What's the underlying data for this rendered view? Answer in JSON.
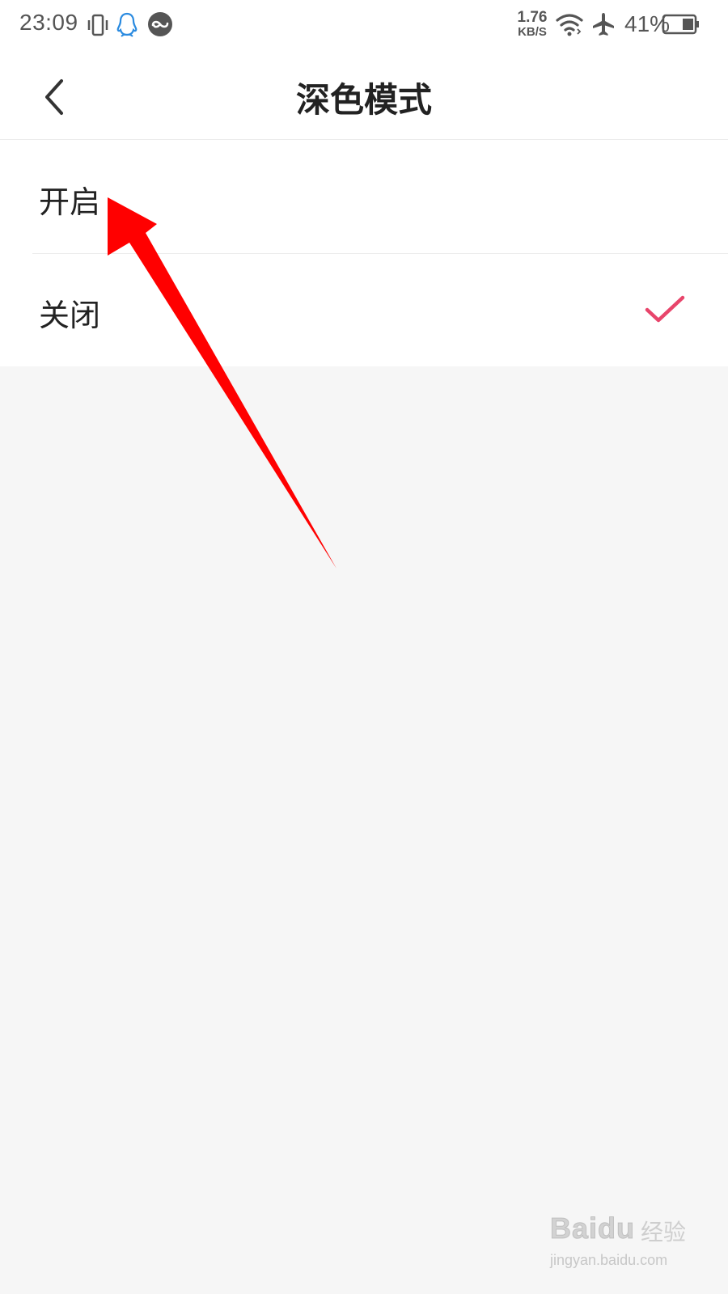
{
  "status_bar": {
    "time": "23:09",
    "icons_left": [
      "vibrate-icon",
      "qq-icon",
      "app-notification-icon"
    ],
    "network_speed_value": "1.76",
    "network_speed_unit": "KB/S",
    "icons_right": [
      "wifi-icon",
      "airplane-mode-icon",
      "battery-icon"
    ],
    "battery_percent": "41%"
  },
  "header": {
    "title": "深色模式",
    "back_icon": "chevron-left-icon"
  },
  "options": [
    {
      "label": "开启",
      "selected": false
    },
    {
      "label": "关闭",
      "selected": true
    }
  ],
  "colors": {
    "accent_check": "#e8456b",
    "annotation_arrow": "#ff0000",
    "page_background": "#f6f6f6"
  },
  "watermark": {
    "brand": "Baidu",
    "product": "经验",
    "url": "jingyan.baidu.com"
  }
}
